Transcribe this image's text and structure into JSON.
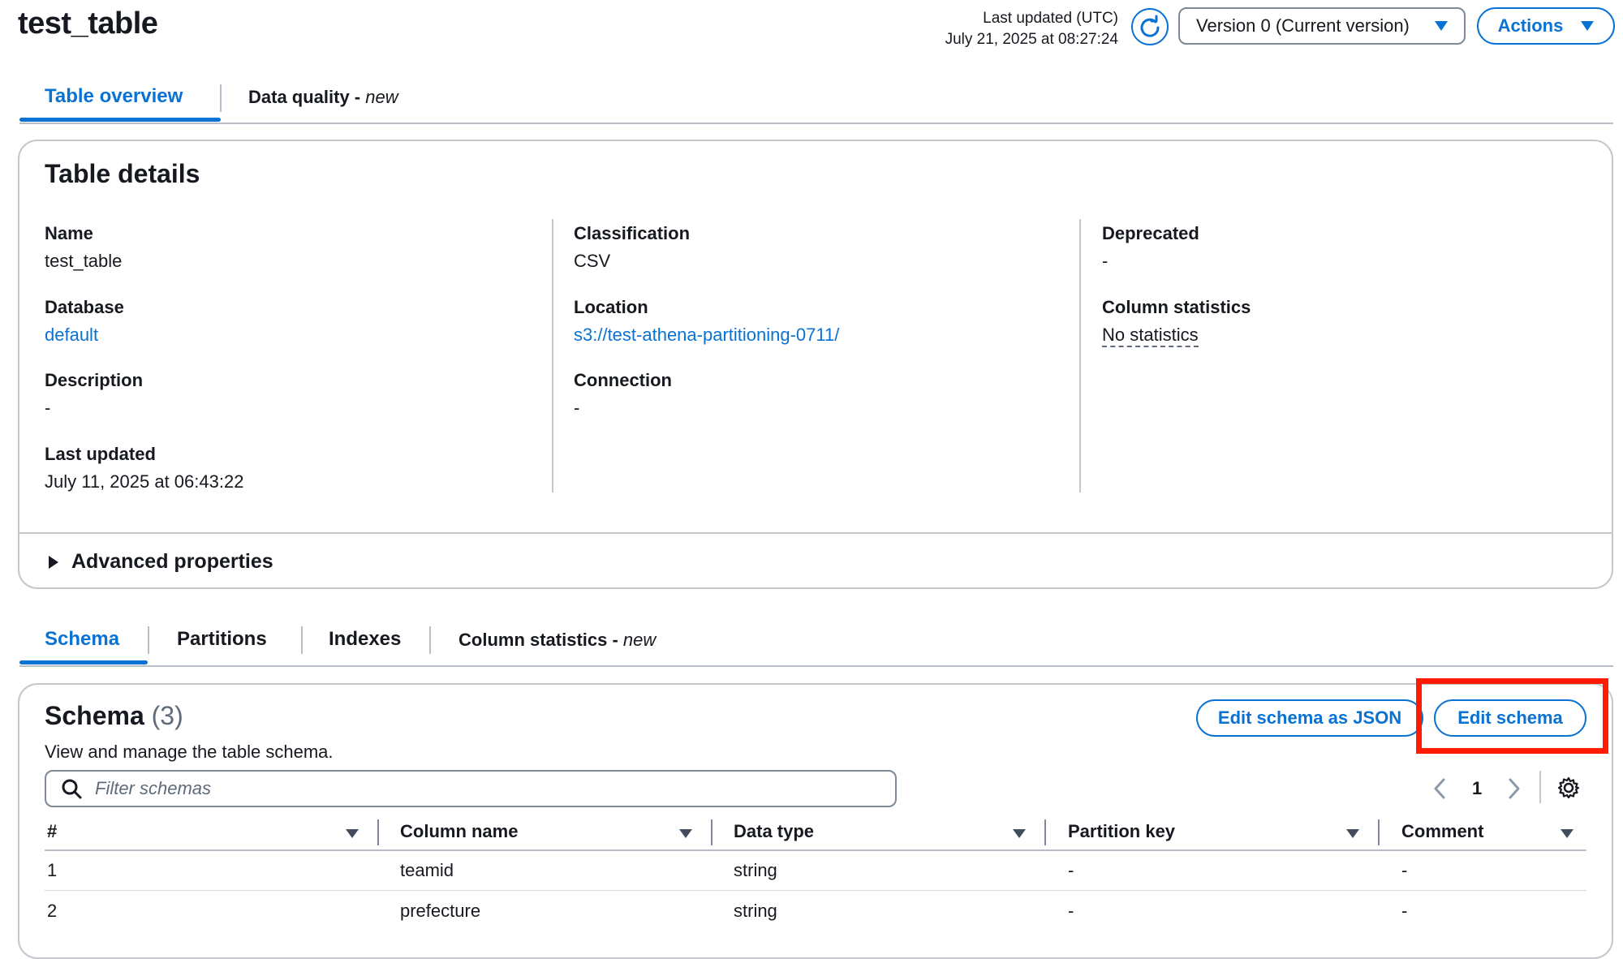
{
  "header": {
    "title": "test_table",
    "last_updated_label": "Last updated (UTC)",
    "last_updated_value": "July 21, 2025 at 08:27:24",
    "version_label": "Version 0 (Current version)",
    "actions_label": "Actions"
  },
  "top_tabs": [
    {
      "label": "Table overview",
      "active": true
    },
    {
      "label": "Data quality - ",
      "suffix": "new",
      "active": false
    }
  ],
  "table_details": {
    "title": "Table details",
    "col1": [
      {
        "label": "Name",
        "value": "test_table"
      },
      {
        "label": "Database",
        "value": "default"
      },
      {
        "label": "Description",
        "value": "-"
      },
      {
        "label": "Last updated",
        "value": "July 11, 2025 at 06:43:22"
      }
    ],
    "col2": [
      {
        "label": "Classification",
        "value": "CSV"
      },
      {
        "label": "Location",
        "value": "s3://test-athena-partitioning-0711/"
      },
      {
        "label": "Connection",
        "value": "-"
      }
    ],
    "col3": [
      {
        "label": "Deprecated",
        "value": "-"
      },
      {
        "label": "Column statistics",
        "value": "No statistics"
      }
    ],
    "advanced_label": "Advanced properties"
  },
  "bottom_tabs": [
    {
      "label": "Schema",
      "active": true
    },
    {
      "label": "Partitions",
      "active": false
    },
    {
      "label": "Indexes",
      "active": false
    },
    {
      "label": "Column statistics - ",
      "suffix": "new",
      "active": false
    }
  ],
  "schema": {
    "title": "Schema",
    "count": "(3)",
    "description": "View and manage the table schema.",
    "edit_json_label": "Edit schema as JSON",
    "edit_label": "Edit schema",
    "filter_placeholder": "Filter schemas",
    "page": "1",
    "columns": [
      "#",
      "Column name",
      "Data type",
      "Partition key",
      "Comment"
    ],
    "rows": [
      [
        "1",
        "teamid",
        "string",
        "-",
        "-"
      ],
      [
        "2",
        "prefecture",
        "string",
        "-",
        "-"
      ]
    ]
  },
  "colors": {
    "accent": "#0972d3",
    "highlight": "#ff1a00",
    "border": "#c6c6cd"
  }
}
